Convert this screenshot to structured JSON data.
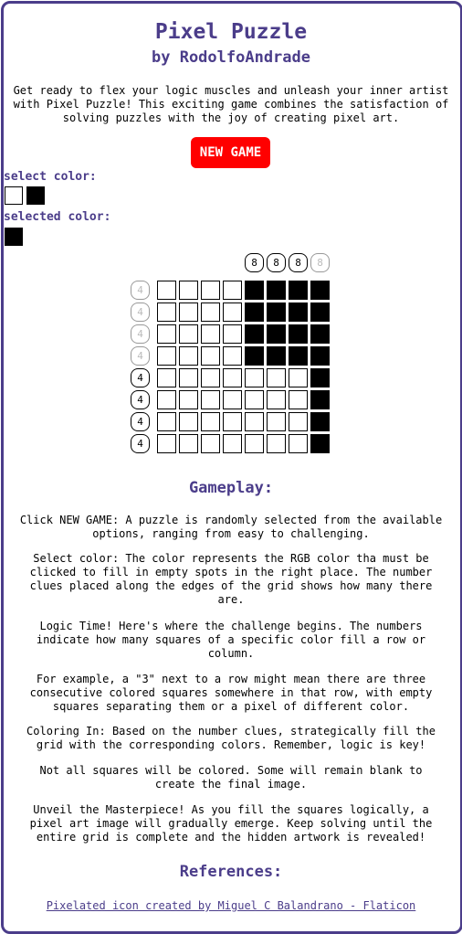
{
  "header": {
    "title": "Pixel Puzzle",
    "author": "by RodolfoAndrade"
  },
  "intro": "Get ready to flex your logic muscles and unleash your inner artist with Pixel Puzzle! This exciting game combines the satisfaction of solving puzzles with the joy of creating pixel art.",
  "new_game_label": "NEW GAME",
  "select_color_label": "select color:",
  "selected_color_label": "selected color:",
  "palette": [
    "#ffffff",
    "#000000"
  ],
  "selected_color": "#000000",
  "puzzle": {
    "column_clues": [
      "8",
      "8",
      "8",
      "8"
    ],
    "column_clue_done": [
      false,
      false,
      false,
      true
    ],
    "row_clues": [
      "4",
      "4",
      "4",
      "4",
      "4",
      "4",
      "4",
      "4"
    ],
    "row_clue_done": [
      true,
      true,
      true,
      true,
      false,
      false,
      false,
      false
    ],
    "grid": [
      [
        0,
        0,
        0,
        0,
        1,
        1,
        1,
        1
      ],
      [
        0,
        0,
        0,
        0,
        1,
        1,
        1,
        1
      ],
      [
        0,
        0,
        0,
        0,
        1,
        1,
        1,
        1
      ],
      [
        0,
        0,
        0,
        0,
        1,
        1,
        1,
        1
      ],
      [
        0,
        0,
        0,
        0,
        0,
        0,
        0,
        1
      ],
      [
        0,
        0,
        0,
        0,
        0,
        0,
        0,
        1
      ],
      [
        0,
        0,
        0,
        0,
        0,
        0,
        0,
        1
      ],
      [
        0,
        0,
        0,
        0,
        0,
        0,
        0,
        1
      ]
    ]
  },
  "gameplay": {
    "heading": "Gameplay:",
    "paragraphs": [
      "Click NEW GAME: A puzzle is randomly selected from the available options, ranging from easy to challenging.",
      "Select color: The color represents the RGB color tha must be clicked to fill in empty spots in the right place. The number clues placed along the edges of the grid shows how many there are.",
      "Logic Time! Here's where the challenge begins. The numbers indicate how many squares of a specific color fill a row or column.",
      "For example, a \"3\" next to a row might mean there are three consecutive colored squares somewhere in that row, with empty squares separating them or a pixel of different color.",
      "Coloring In: Based on the number clues, strategically fill the grid with the corresponding colors. Remember, logic is key!",
      "Not all squares will be colored. Some will remain blank to create the final image.",
      "Unveil the Masterpiece! As you fill the squares logically, a pixel art image will gradually emerge. Keep solving until the entire grid is complete and the hidden artwork is revealed!"
    ]
  },
  "references": {
    "heading": "References:",
    "link_text": "Pixelated icon created by Miguel C Balandrano - Flaticon"
  }
}
